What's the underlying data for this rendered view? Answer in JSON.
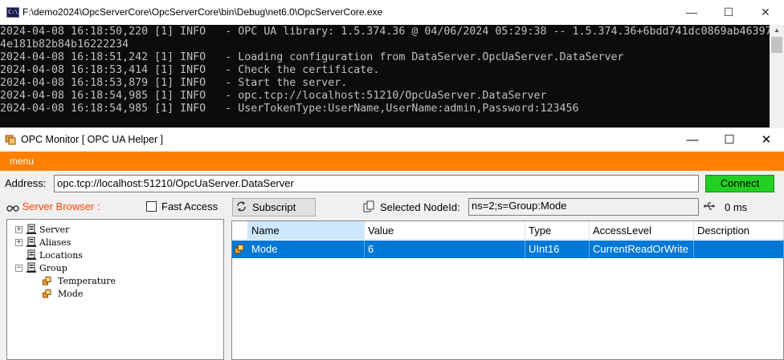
{
  "console": {
    "title": "F:\\demo2024\\OpcServerCore\\OpcServerCore\\bin\\Debug\\net6.0\\OpcServerCore.exe",
    "icon": "console-app-icon",
    "lines": [
      "2024-04-08 16:18:50,220 [1] INFO   - OPC UA library: 1.5.374.36 @ 04/06/2024 05:29:38 -- 1.5.374.36+6bdd741dc0869ab46397",
      "4e181b82b84b16222234",
      "2024-04-08 16:18:51,242 [1] INFO   - Loading configuration from DataServer.OpcUaServer.DataServer",
      "2024-04-08 16:18:53,414 [1] INFO   - Check the certificate.",
      "2024-04-08 16:18:53,879 [1] INFO   - Start the server.",
      "2024-04-08 16:18:54,985 [1] INFO   - opc.tcp://localhost:51210/OpcUaServer.DataServer",
      "2024-04-08 16:18:54,985 [1] INFO   - UserTokenType:UserName,UserName:admin,Password:123456"
    ],
    "buttons": {
      "minimize": "—",
      "maximize": "☐",
      "close": "✕"
    }
  },
  "monitor": {
    "title": "OPC Monitor [ OPC UA Helper ]",
    "buttons": {
      "minimize": "—",
      "maximize": "☐",
      "close": "✕"
    },
    "menu": "menu",
    "accent": "#ff7f00",
    "address_label": "Address:",
    "address_value": "opc.tcp://localhost:51210/OpcUaServer.DataServer",
    "connect_label": "Connect",
    "connect_color": "#21d021",
    "browser_label": "Server Browser :",
    "fast_access_label": "Fast Access",
    "fast_access_checked": false,
    "subscript_label": "Subscript",
    "selected_node_label": "Selected NodeId:",
    "selected_node_value": "ns=2;s=Group:Mode",
    "latency": "0 ms",
    "tree": [
      {
        "label": "Server",
        "expander": "+",
        "icon": "server-icon",
        "level": 0
      },
      {
        "label": "Aliases",
        "expander": "+",
        "icon": "server-icon",
        "level": 0
      },
      {
        "label": "Locations",
        "expander": "",
        "icon": "server-icon",
        "level": 0
      },
      {
        "label": "Group",
        "expander": "−",
        "icon": "server-icon",
        "level": 0
      },
      {
        "label": "Temperature",
        "expander": "",
        "icon": "tag-icon",
        "level": 1
      },
      {
        "label": "Mode",
        "expander": "",
        "icon": "tag-icon",
        "level": 1
      }
    ],
    "grid": {
      "columns": [
        "Name",
        "Value",
        "Type",
        "AccessLevel",
        "Description"
      ],
      "rows": [
        {
          "name": "Mode",
          "value": "6",
          "type": "UInt16",
          "access": "CurrentReadOrWrite",
          "description": ""
        }
      ],
      "selection_color": "#0078d7"
    }
  }
}
